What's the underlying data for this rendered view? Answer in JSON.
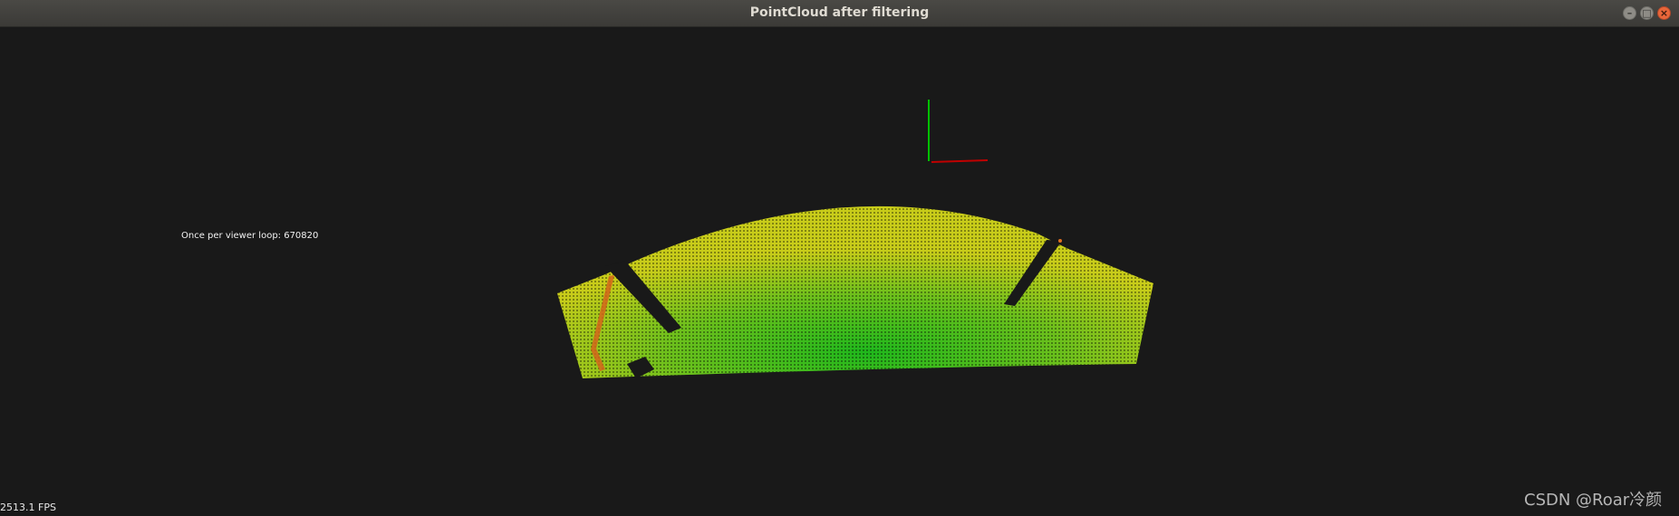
{
  "window": {
    "title": "PointCloud after filtering",
    "controls": {
      "minimize_glyph": "–",
      "maximize_glyph": "□",
      "close_glyph": "×"
    }
  },
  "viewer": {
    "loop_text": "Once per viewer loop: 670820",
    "fps_text": "2513.1 FPS",
    "background_color": "#191919",
    "axes": {
      "y_axis_color": "#00c000",
      "x_axis_color": "#c00000"
    },
    "cloud_colors": {
      "near": "#1fb81c",
      "far": "#c8cc1a",
      "edge_points": "#d4651a"
    }
  },
  "watermark": {
    "text": "CSDN @Roar冷颜"
  }
}
